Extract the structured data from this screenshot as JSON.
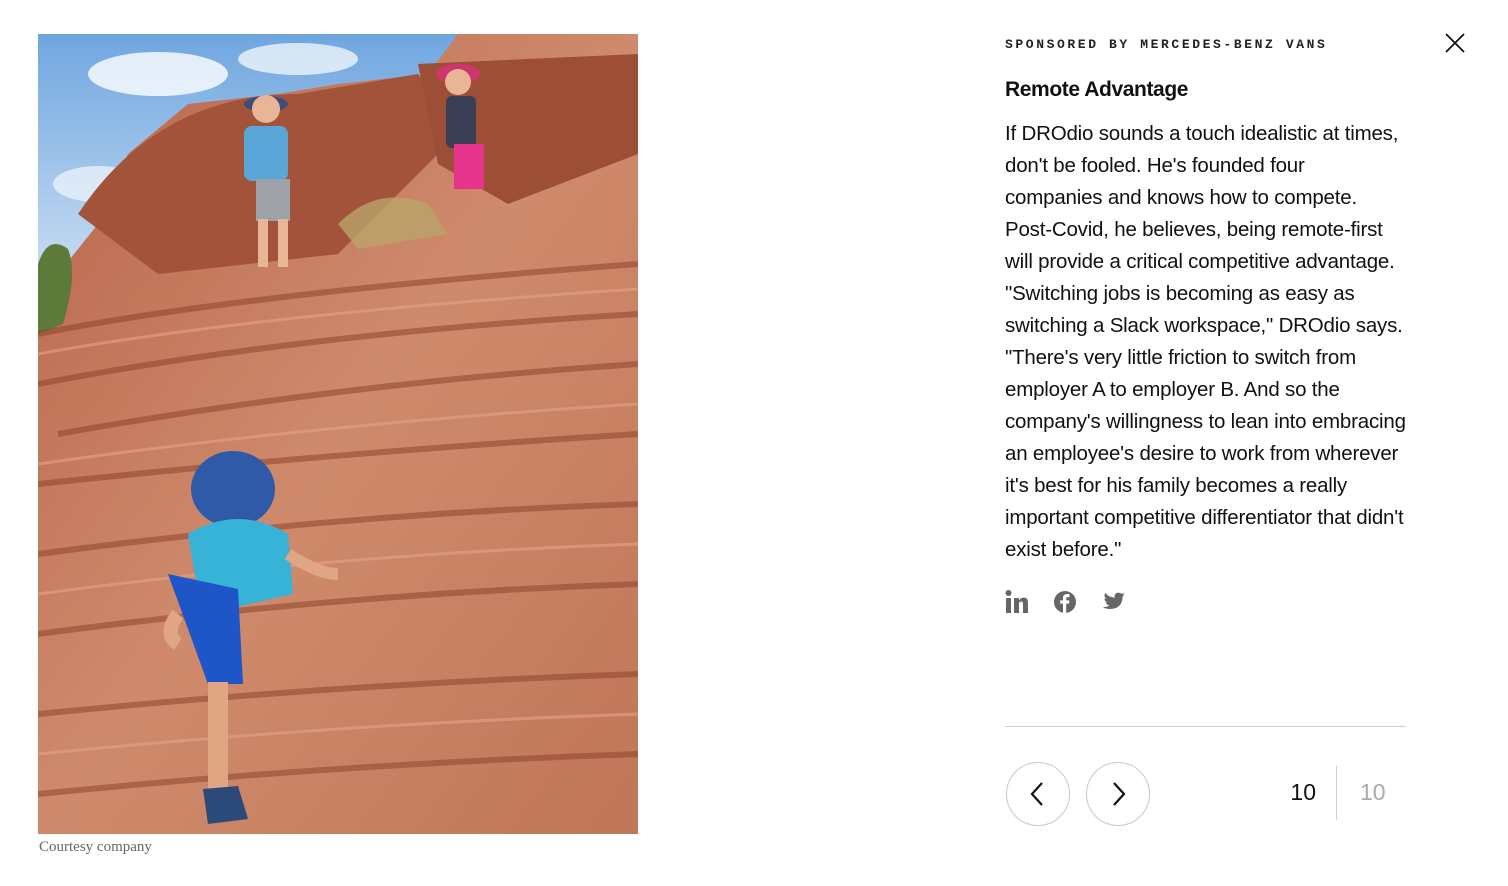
{
  "gallery": {
    "photo_caption": "Courtesy company",
    "close_icon": "close-icon",
    "current_index": "10",
    "total_count": "10",
    "prev_icon": "chevron-left-icon",
    "next_icon": "chevron-right-icon"
  },
  "article": {
    "sponsor_label": "SPONSORED BY MERCEDES-BENZ VANS",
    "title": "Remote Advantage",
    "body": "If DROdio sounds a touch idealistic at times, don't be fooled. He's founded four companies and knows how to compete. Post-Covid, he believes, being remote-first will provide a critical competitive advantage. \"Switching jobs is becoming as easy as switching a Slack workspace,\" DROdio says. \"There's very little friction to switch from employer A to employer B. And so the company's willingness to lean into embracing an employee's desire to work from wherever it's best for his family becomes a really important competitive differentiator that didn't exist before.\""
  },
  "share": {
    "icons": [
      "linkedin-icon",
      "facebook-icon",
      "twitter-icon"
    ]
  },
  "colors": {
    "icon_gray": "#666666",
    "rock": "#c8785a",
    "sky": "#7fb0e6"
  }
}
